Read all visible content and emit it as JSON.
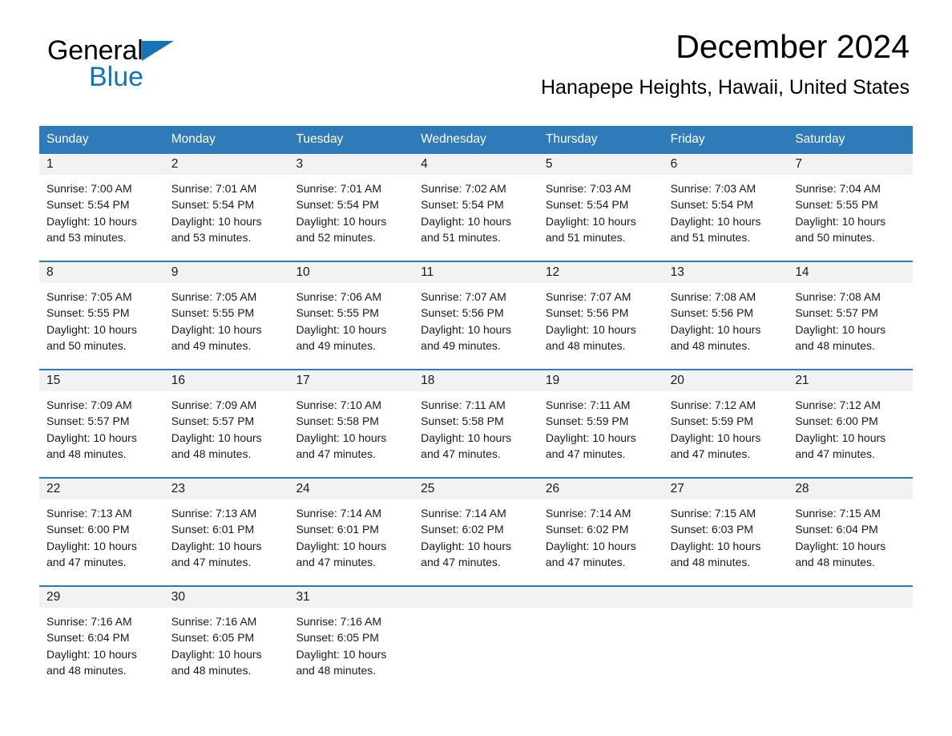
{
  "brand": {
    "name_part1": "General",
    "name_part2": "Blue",
    "logo_icon": "triangle-icon",
    "accent_color": "#1574b8"
  },
  "header": {
    "title": "December 2024",
    "subtitle": "Hanapepe Heights, Hawaii, United States"
  },
  "colors": {
    "header_blue": "#2f7ab8",
    "daynum_band": "#f2f2f2",
    "text": "#1a1a1a"
  },
  "weekdays": [
    "Sunday",
    "Monday",
    "Tuesday",
    "Wednesday",
    "Thursday",
    "Friday",
    "Saturday"
  ],
  "weeks": [
    [
      {
        "day": "1",
        "sunrise": "Sunrise: 7:00 AM",
        "sunset": "Sunset: 5:54 PM",
        "daylight": "Daylight: 10 hours and 53 minutes."
      },
      {
        "day": "2",
        "sunrise": "Sunrise: 7:01 AM",
        "sunset": "Sunset: 5:54 PM",
        "daylight": "Daylight: 10 hours and 53 minutes."
      },
      {
        "day": "3",
        "sunrise": "Sunrise: 7:01 AM",
        "sunset": "Sunset: 5:54 PM",
        "daylight": "Daylight: 10 hours and 52 minutes."
      },
      {
        "day": "4",
        "sunrise": "Sunrise: 7:02 AM",
        "sunset": "Sunset: 5:54 PM",
        "daylight": "Daylight: 10 hours and 51 minutes."
      },
      {
        "day": "5",
        "sunrise": "Sunrise: 7:03 AM",
        "sunset": "Sunset: 5:54 PM",
        "daylight": "Daylight: 10 hours and 51 minutes."
      },
      {
        "day": "6",
        "sunrise": "Sunrise: 7:03 AM",
        "sunset": "Sunset: 5:54 PM",
        "daylight": "Daylight: 10 hours and 51 minutes."
      },
      {
        "day": "7",
        "sunrise": "Sunrise: 7:04 AM",
        "sunset": "Sunset: 5:55 PM",
        "daylight": "Daylight: 10 hours and 50 minutes."
      }
    ],
    [
      {
        "day": "8",
        "sunrise": "Sunrise: 7:05 AM",
        "sunset": "Sunset: 5:55 PM",
        "daylight": "Daylight: 10 hours and 50 minutes."
      },
      {
        "day": "9",
        "sunrise": "Sunrise: 7:05 AM",
        "sunset": "Sunset: 5:55 PM",
        "daylight": "Daylight: 10 hours and 49 minutes."
      },
      {
        "day": "10",
        "sunrise": "Sunrise: 7:06 AM",
        "sunset": "Sunset: 5:55 PM",
        "daylight": "Daylight: 10 hours and 49 minutes."
      },
      {
        "day": "11",
        "sunrise": "Sunrise: 7:07 AM",
        "sunset": "Sunset: 5:56 PM",
        "daylight": "Daylight: 10 hours and 49 minutes."
      },
      {
        "day": "12",
        "sunrise": "Sunrise: 7:07 AM",
        "sunset": "Sunset: 5:56 PM",
        "daylight": "Daylight: 10 hours and 48 minutes."
      },
      {
        "day": "13",
        "sunrise": "Sunrise: 7:08 AM",
        "sunset": "Sunset: 5:56 PM",
        "daylight": "Daylight: 10 hours and 48 minutes."
      },
      {
        "day": "14",
        "sunrise": "Sunrise: 7:08 AM",
        "sunset": "Sunset: 5:57 PM",
        "daylight": "Daylight: 10 hours and 48 minutes."
      }
    ],
    [
      {
        "day": "15",
        "sunrise": "Sunrise: 7:09 AM",
        "sunset": "Sunset: 5:57 PM",
        "daylight": "Daylight: 10 hours and 48 minutes."
      },
      {
        "day": "16",
        "sunrise": "Sunrise: 7:09 AM",
        "sunset": "Sunset: 5:57 PM",
        "daylight": "Daylight: 10 hours and 48 minutes."
      },
      {
        "day": "17",
        "sunrise": "Sunrise: 7:10 AM",
        "sunset": "Sunset: 5:58 PM",
        "daylight": "Daylight: 10 hours and 47 minutes."
      },
      {
        "day": "18",
        "sunrise": "Sunrise: 7:11 AM",
        "sunset": "Sunset: 5:58 PM",
        "daylight": "Daylight: 10 hours and 47 minutes."
      },
      {
        "day": "19",
        "sunrise": "Sunrise: 7:11 AM",
        "sunset": "Sunset: 5:59 PM",
        "daylight": "Daylight: 10 hours and 47 minutes."
      },
      {
        "day": "20",
        "sunrise": "Sunrise: 7:12 AM",
        "sunset": "Sunset: 5:59 PM",
        "daylight": "Daylight: 10 hours and 47 minutes."
      },
      {
        "day": "21",
        "sunrise": "Sunrise: 7:12 AM",
        "sunset": "Sunset: 6:00 PM",
        "daylight": "Daylight: 10 hours and 47 minutes."
      }
    ],
    [
      {
        "day": "22",
        "sunrise": "Sunrise: 7:13 AM",
        "sunset": "Sunset: 6:00 PM",
        "daylight": "Daylight: 10 hours and 47 minutes."
      },
      {
        "day": "23",
        "sunrise": "Sunrise: 7:13 AM",
        "sunset": "Sunset: 6:01 PM",
        "daylight": "Daylight: 10 hours and 47 minutes."
      },
      {
        "day": "24",
        "sunrise": "Sunrise: 7:14 AM",
        "sunset": "Sunset: 6:01 PM",
        "daylight": "Daylight: 10 hours and 47 minutes."
      },
      {
        "day": "25",
        "sunrise": "Sunrise: 7:14 AM",
        "sunset": "Sunset: 6:02 PM",
        "daylight": "Daylight: 10 hours and 47 minutes."
      },
      {
        "day": "26",
        "sunrise": "Sunrise: 7:14 AM",
        "sunset": "Sunset: 6:02 PM",
        "daylight": "Daylight: 10 hours and 47 minutes."
      },
      {
        "day": "27",
        "sunrise": "Sunrise: 7:15 AM",
        "sunset": "Sunset: 6:03 PM",
        "daylight": "Daylight: 10 hours and 48 minutes."
      },
      {
        "day": "28",
        "sunrise": "Sunrise: 7:15 AM",
        "sunset": "Sunset: 6:04 PM",
        "daylight": "Daylight: 10 hours and 48 minutes."
      }
    ],
    [
      {
        "day": "29",
        "sunrise": "Sunrise: 7:16 AM",
        "sunset": "Sunset: 6:04 PM",
        "daylight": "Daylight: 10 hours and 48 minutes."
      },
      {
        "day": "30",
        "sunrise": "Sunrise: 7:16 AM",
        "sunset": "Sunset: 6:05 PM",
        "daylight": "Daylight: 10 hours and 48 minutes."
      },
      {
        "day": "31",
        "sunrise": "Sunrise: 7:16 AM",
        "sunset": "Sunset: 6:05 PM",
        "daylight": "Daylight: 10 hours and 48 minutes."
      },
      {
        "day": "",
        "sunrise": "",
        "sunset": "",
        "daylight": ""
      },
      {
        "day": "",
        "sunrise": "",
        "sunset": "",
        "daylight": ""
      },
      {
        "day": "",
        "sunrise": "",
        "sunset": "",
        "daylight": ""
      },
      {
        "day": "",
        "sunrise": "",
        "sunset": "",
        "daylight": ""
      }
    ]
  ]
}
